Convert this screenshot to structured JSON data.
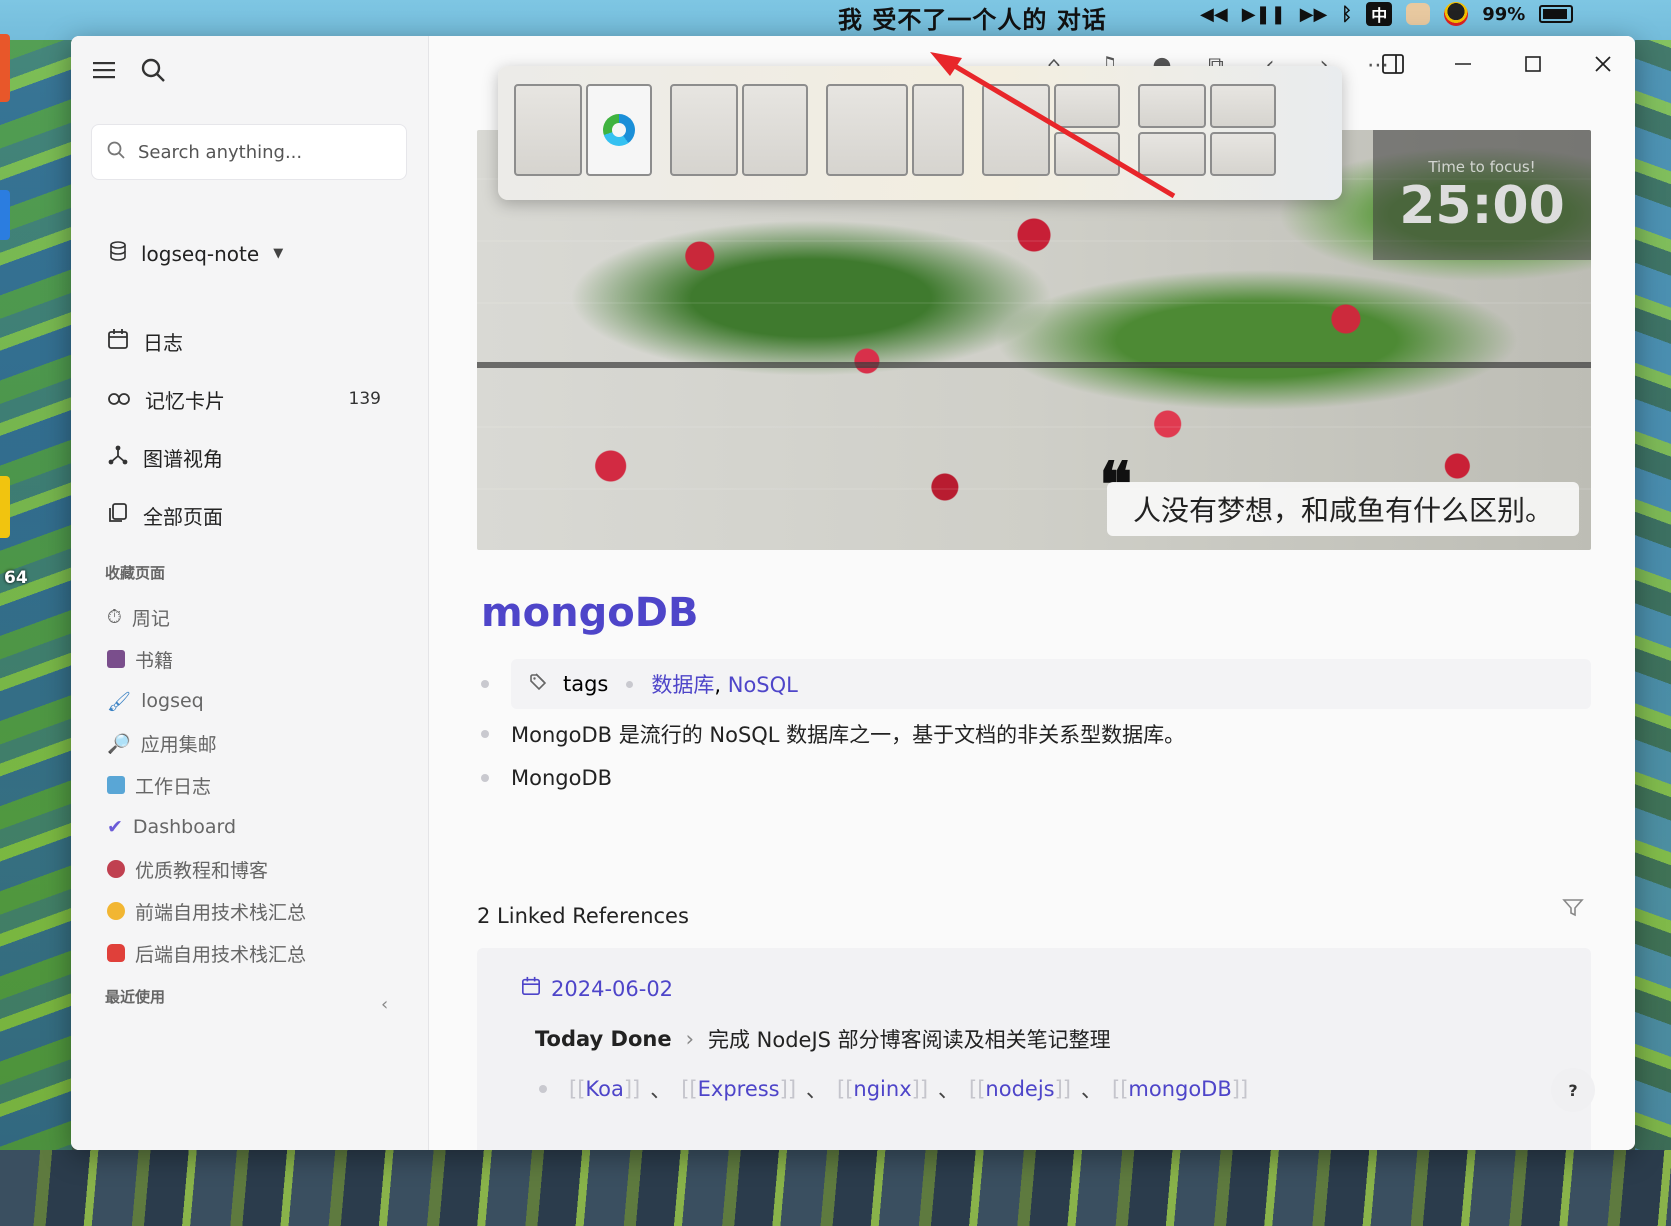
{
  "desktop": {
    "now_playing": "我 受不了一个人的 对话",
    "battery": "99%",
    "ime": "中",
    "desktop_label": "64"
  },
  "window": {
    "search": {
      "placeholder": "Search anything..."
    },
    "graph": {
      "name": "logseq-note"
    },
    "nav": [
      {
        "label": "日志",
        "icon": "calendar-icon"
      },
      {
        "label": "记忆卡片",
        "icon": "flashcards-icon",
        "count": "139"
      },
      {
        "label": "图谱视角",
        "icon": "graph-icon"
      },
      {
        "label": "全部页面",
        "icon": "pages-icon"
      }
    ],
    "favorites_title": "收藏页面",
    "favorites": [
      {
        "label": "周记",
        "icon": "stopwatch-icon",
        "color": "#8a8a8a"
      },
      {
        "label": "书籍",
        "icon": "book-icon",
        "color": "#7a4e8c"
      },
      {
        "label": "logseq",
        "icon": "paintbrush-icon",
        "color": "#3b82c4"
      },
      {
        "label": "应用集邮",
        "icon": "magnifier-icon",
        "color": "#2a8fd0"
      },
      {
        "label": "工作日志",
        "icon": "computer-icon",
        "color": "#59a6d6"
      },
      {
        "label": "Dashboard",
        "icon": "checkmark-icon",
        "color": "#6b5bd8"
      },
      {
        "label": "优质教程和博客",
        "icon": "robot-icon",
        "color": "#c04050"
      },
      {
        "label": "前端自用技术栈汇总",
        "icon": "chick-icon",
        "color": "#f2b632"
      },
      {
        "label": "后端自用技术栈汇总",
        "icon": "bag-icon",
        "color": "#e0403a"
      }
    ],
    "recent_title": "最近使用",
    "banner": {
      "timer_caption": "Time to focus!",
      "timer": "25:00",
      "quote": "人没有梦想，和咸鱼有什么区别。"
    },
    "page": {
      "title": "mongoDB",
      "tags_key": "tags",
      "tags": [
        "数据库",
        "NoSQL"
      ],
      "blocks": [
        "MongoDB 是流行的 NoSQL 数据库之一，基于文档的非关系型数据库。",
        "MongoDB"
      ]
    },
    "linked_refs": {
      "heading": "2 Linked References",
      "date": "2024-06-02",
      "crumb_parent": "Today Done",
      "crumb_child": "完成 NodeJS 部分博客阅读及相关笔记整理",
      "links": [
        "Koa",
        "Express",
        "nginx",
        "nodejs",
        "mongoDB"
      ]
    },
    "help": "?"
  }
}
